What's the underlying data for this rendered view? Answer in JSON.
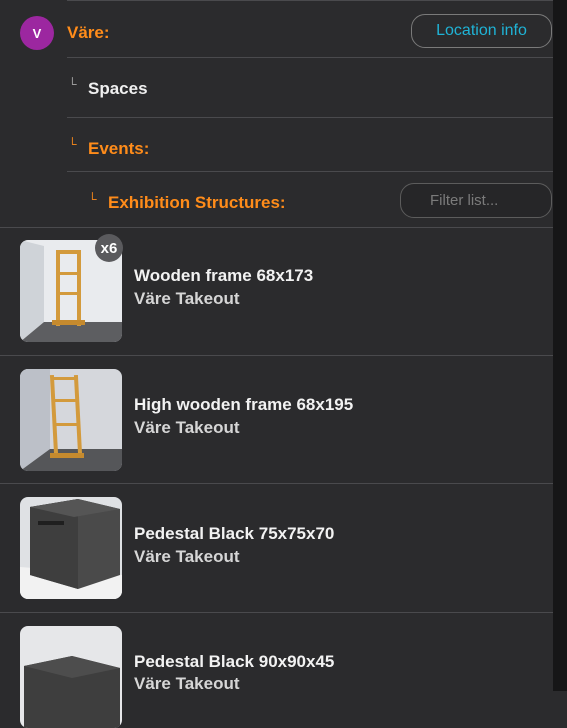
{
  "header": {
    "avatar_letter": "V",
    "location_label": "Väre:",
    "location_info_button": "Location info"
  },
  "tree": {
    "spaces_label": "Spaces",
    "events_label": "Events:",
    "exhibition_label": "Exhibition Structures:"
  },
  "filter": {
    "placeholder": "Filter list..."
  },
  "items": [
    {
      "title": "Wooden frame 68x173",
      "subtitle": "Väre Takeout",
      "badge": "x6"
    },
    {
      "title": "High wooden frame 68x195",
      "subtitle": "Väre Takeout"
    },
    {
      "title": "Pedestal Black 75x75x70",
      "subtitle": "Väre Takeout"
    },
    {
      "title": "Pedestal Black 90x90x45",
      "subtitle": "Väre Takeout"
    }
  ],
  "colors": {
    "accent_orange": "#ff8c1a",
    "link_cyan": "#1fb3d6",
    "avatar_purple": "#9c27a0"
  }
}
